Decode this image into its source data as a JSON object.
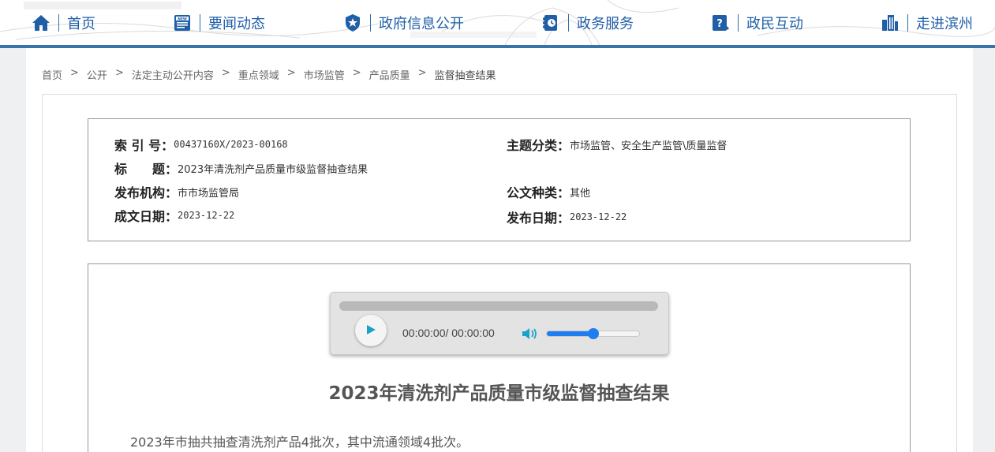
{
  "nav": {
    "items": [
      {
        "label": "首页",
        "icon": "home-icon"
      },
      {
        "label": "要闻动态",
        "icon": "news-icon"
      },
      {
        "label": "政府信息公开",
        "icon": "badge-icon"
      },
      {
        "label": "政务服务",
        "icon": "service-icon"
      },
      {
        "label": "政民互动",
        "icon": "question-icon"
      },
      {
        "label": "走进滨州",
        "icon": "building-icon"
      }
    ],
    "accent": "#1f5fa8"
  },
  "breadcrumb": {
    "items": [
      "首页",
      "公开",
      "法定主动公开内容",
      "重点领域",
      "市场监管",
      "产品质量",
      "监督抽查结果"
    ],
    "separator": ">"
  },
  "meta": {
    "index_label": "索 引 号：",
    "index_value": "00437160X/2023-00168",
    "subject_label": "主题分类：",
    "subject_value": "市场监管、安全生产监管\\质量监督",
    "title_label": "标　　题：",
    "title_value": "2023年清洗剂产品质量市级监督抽查结果",
    "issuer_label": "发布机构：",
    "issuer_value": "市市场监管局",
    "doctype_label": "公文种类：",
    "doctype_value": "其他",
    "written_label": "成文日期：",
    "written_value": "2023-12-22",
    "published_label": "发布日期：",
    "published_value": "2023-12-22"
  },
  "player": {
    "time": "00:00:00/ 00:00:00",
    "volume": 0.5,
    "accent": "#1e7ef0"
  },
  "article": {
    "title": "2023年清洗剂产品质量市级监督抽查结果",
    "paragraph": "2023年市抽共抽查清洗剂产品4批次，其中流通领域4批次。"
  }
}
